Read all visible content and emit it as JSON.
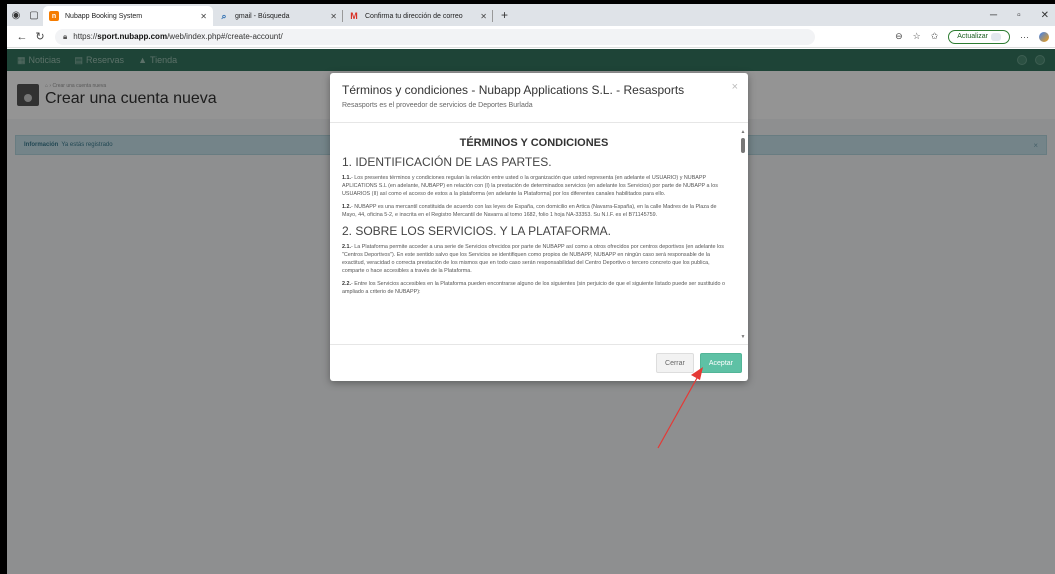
{
  "browser": {
    "tabs": [
      {
        "label": "Nubapp Booking System",
        "favicon_color": "#f57c00",
        "active": true
      },
      {
        "label": "gmail - Búsqueda",
        "favicon_color": "#2b6cb0",
        "active": false
      },
      {
        "label": "Confirma tu dirección de correo",
        "favicon_color": "#d93025",
        "active": false
      }
    ],
    "url_prefix": "https://",
    "url_host": "sport.nubapp.com",
    "url_path": "/web/index.php#/create-account/",
    "update_label": "Actualizar"
  },
  "app": {
    "nav": [
      "Noticias",
      "Reservas",
      "Tienda"
    ],
    "breadcrumb": "Crear una cuenta nueva",
    "title": "Crear una cuenta nueva",
    "info_label": "Información",
    "info_text": "Ya estás registrado"
  },
  "modal": {
    "title": "Términos y condiciones - Nubapp Applications S.L. - Resasports",
    "subtitle": "Resasports es el proveedor de servicios de Deportes Burlada",
    "doc_title": "TÉRMINOS Y CONDICIONES",
    "section1": "1. IDENTIFICACIÓN DE LAS PARTES.",
    "p11_num": "1.1.",
    "p11": "- Los presentes términos y condiciones regulan la relación entre usted o la organización que usted representa (en adelante el USUARIO) y NUBAPP APLICATIONS S.L (en adelante, NUBAPP) en relación con (I) la prestación de determinados servicios (en adelante los Servicios) por parte de NUBAPP a los USUARIOS (II) así como el acceso de estos a la plataforma (en adelante la Plataforma) por los diferentes canales habilitados para ello.",
    "p12_num": "1.2.",
    "p12": "- NUBAPP es una mercantil constituida de acuerdo con las leyes de España, con domicilio en Artica (Navarra-España), en la calle Madres de la Plaza de Mayo, 44, oficina 5-2, e inscrita en el Registro Mercantil de Navarra al tomo 1682, folio 1 hoja NA-33353. Su N.I.F. es el B71145759.",
    "section2": "2. SOBRE LOS SERVICIOS. Y LA PLATAFORMA.",
    "p21_num": "2.1.",
    "p21": "- La Plataforma permite acceder a una serie de Servicios ofrecidos por parte de NUBAPP así como a otros ofrecidos por centros deportivos (en adelante los \"Centros Deportivos\"). En este sentido salvo que los Servicios se identifiquen como propios de NUBAPP, NUBAPP en ningún caso será responsable de la exactitud, veracidad o correcta prestación de los mismos que en todo caso serán responsabilidad del Centro Deportivo o tercero concreto que los publica, comparte o hace accesibles a través de la Plataforma.",
    "p22_num": "2.2.",
    "p22": "- Entre los Servicios accesibles en la Plataforma pueden encontrarse alguno de los siguientes (sin perjuicio de que el siguiente listado puede ser sustituido o ampliado a criterio de NUBAPP):",
    "cancel_label": "Cerrar",
    "accept_label": "Aceptar"
  },
  "colors": {
    "nav_bg": "#34765f",
    "accept": "#5ec1a5",
    "annotation": "#e53935"
  }
}
